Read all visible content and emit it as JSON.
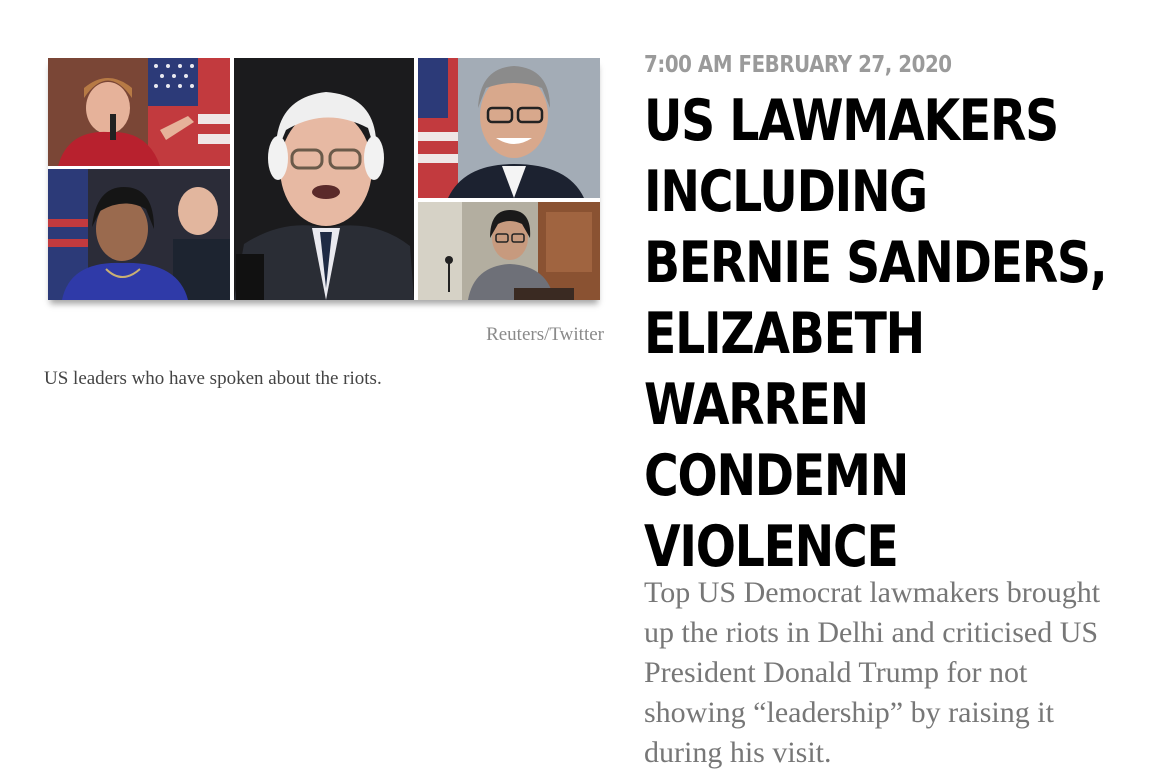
{
  "image": {
    "credit": "Reuters/Twitter",
    "caption": "US leaders who have spoken about the riots.",
    "panels": [
      {
        "name": "photo-elizabeth-warren",
        "bg": "#7b4a3a",
        "accent": "#b01c2c"
      },
      {
        "name": "photo-pramila-jayapal",
        "bg": "#2a2a3a",
        "accent": "#2a3aa0"
      },
      {
        "name": "photo-bernie-sanders",
        "bg": "#1d1d1f",
        "accent": "#2b2e36"
      },
      {
        "name": "photo-alan-lowenthal",
        "bg": "#9aa3ad",
        "accent": "#1c2230"
      },
      {
        "name": "photo-rashida-tlaib",
        "bg": "#8a5a38",
        "accent": "#6f6f78"
      }
    ]
  },
  "article": {
    "timestamp": "7:00 AM FEBRUARY 27, 2020",
    "headline": "US LAWMAKERS INCLUDING BERNIE SANDERS, ELIZABETH WARREN CONDEMN VIOLENCE",
    "summary": "Top US Democrat lawmakers brought up the riots in Delhi and criticised US President Donald Trump for not showing “leadership” by raising it during his visit."
  }
}
